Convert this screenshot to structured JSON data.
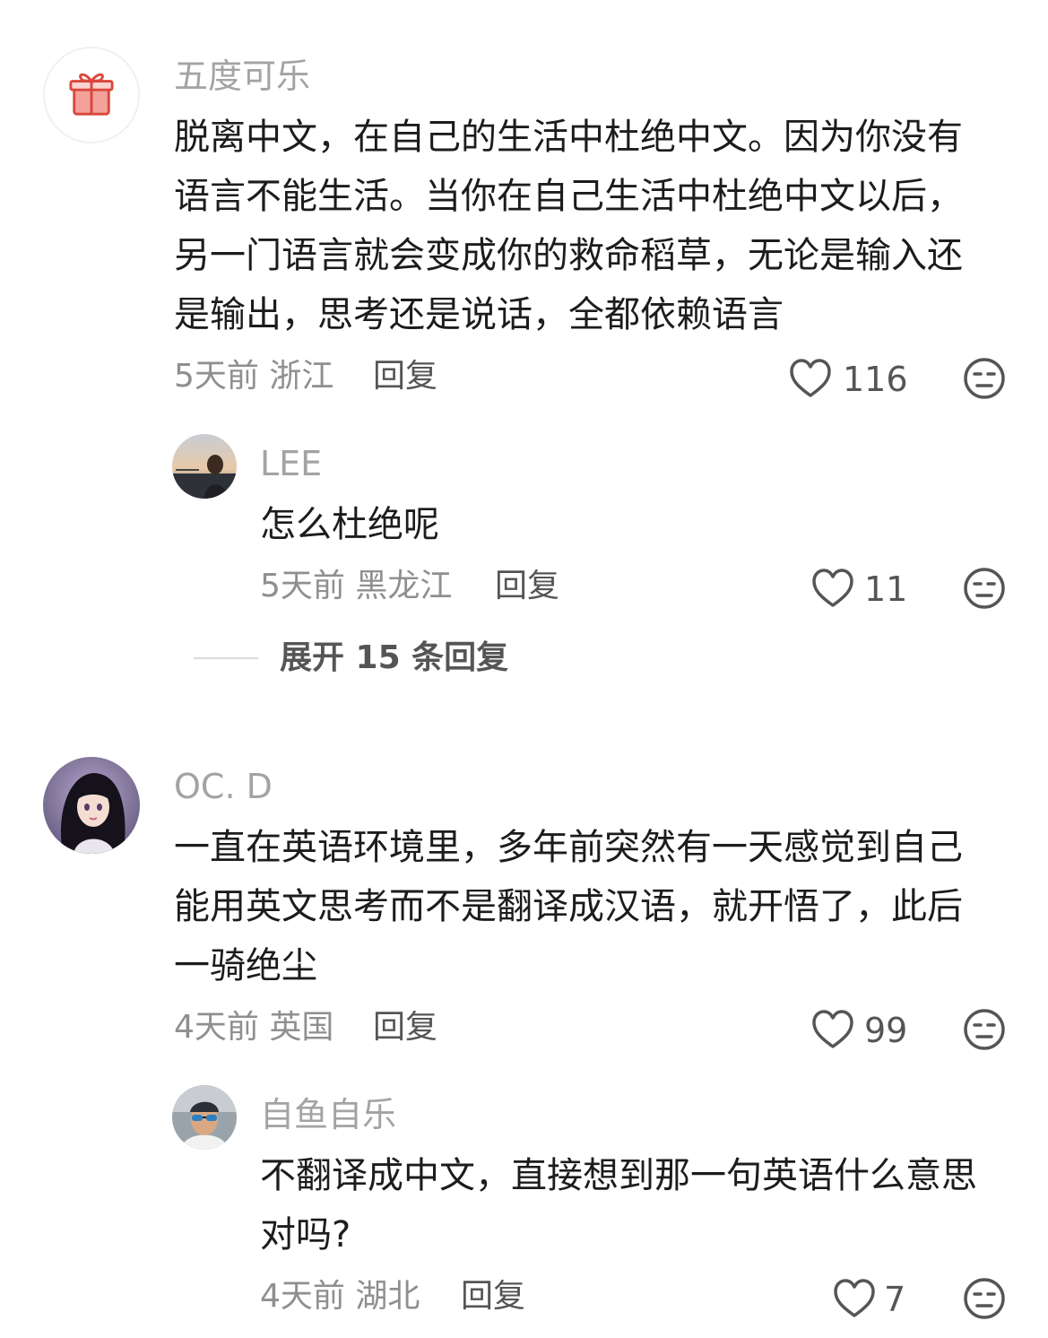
{
  "colors": {
    "username": "#a3a3a3",
    "text": "#1c1c1c",
    "meta": "#8f8f8f",
    "action": "#555555",
    "divider": "#dcdcdc"
  },
  "comments": [
    {
      "username": "五度可乐",
      "avatar_icon": "gift-icon",
      "text": "脱离中文，在自己的生活中杜绝中文。因为你没有\n语言不能生活。当你在自己生活中杜绝中文以后，\n另一门语言就会变成你的救命稻草，无论是输入还\n是输出，思考还是说话，全都依赖语言",
      "meta": "5天前 浙江",
      "reply_label": "回复",
      "likes": "116",
      "reply": {
        "username": "LEE",
        "text": "怎么杜绝呢",
        "meta": "5天前 黑龙江",
        "reply_label": "回复",
        "likes": "11"
      },
      "expand_label": "展开 15 条回复"
    },
    {
      "username": "OC. D",
      "text": "一直在英语环境里，多年前突然有一天感觉到自己\n能用英文思考而不是翻译成汉语，就开悟了，此后\n一骑绝尘",
      "meta": "4天前 英国",
      "reply_label": "回复",
      "likes": "99",
      "reply": {
        "username": "自鱼自乐",
        "text": "不翻译成中文，直接想到那一句英语什么意思\n对吗?",
        "meta": "4天前 湖北",
        "reply_label": "回复",
        "likes": "7"
      }
    }
  ]
}
